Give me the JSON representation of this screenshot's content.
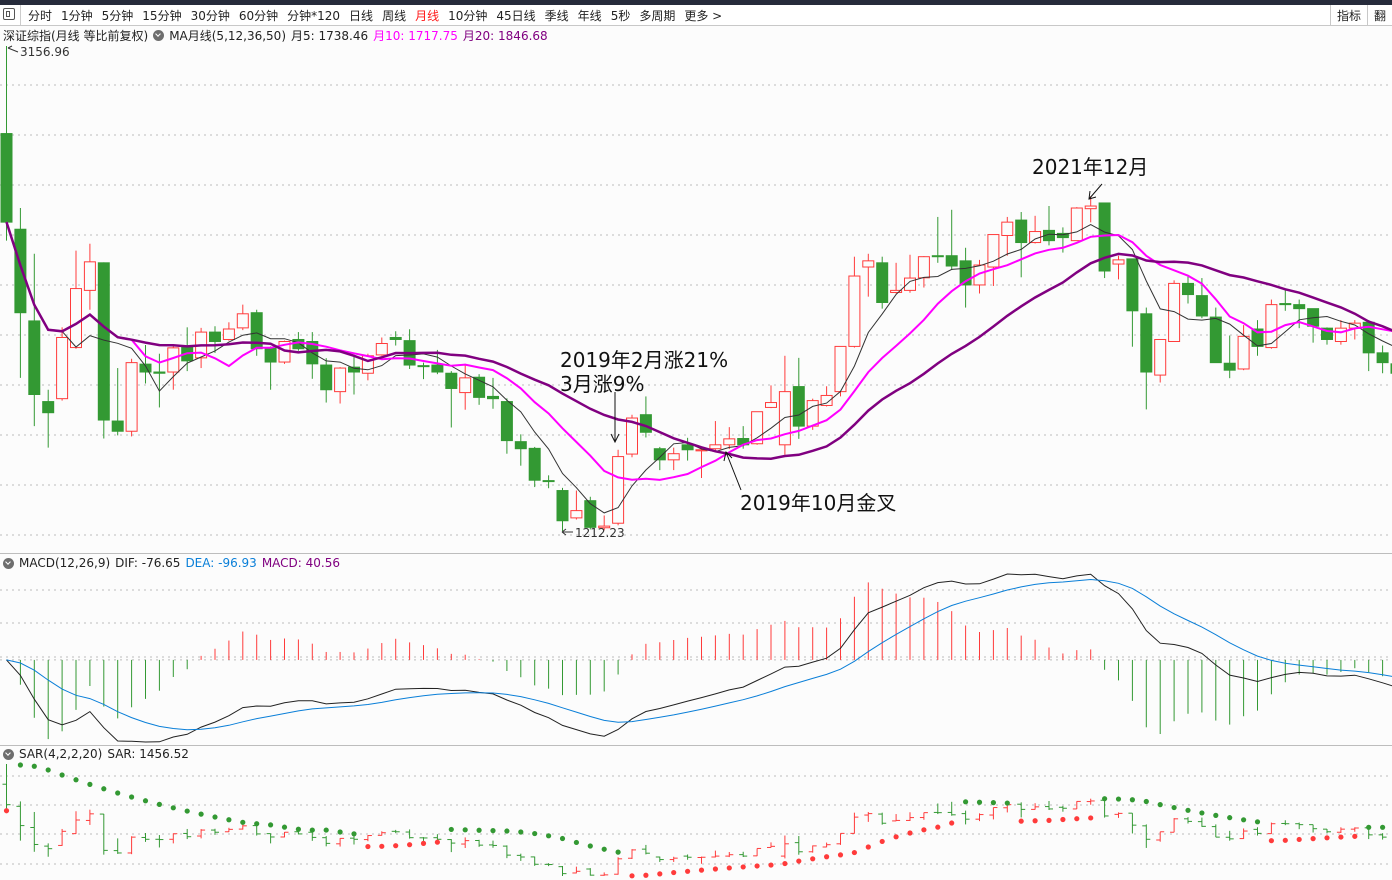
{
  "toolbar": {
    "items": [
      "分时",
      "1分钟",
      "5分钟",
      "15分钟",
      "30分钟",
      "60分钟",
      "分钟*120",
      "日线",
      "周线",
      "月线",
      "10分钟",
      "45日线",
      "季线",
      "年线",
      "5秒",
      "多周期",
      "更多 >"
    ],
    "active_index": 9,
    "right": [
      "指标",
      "翻"
    ]
  },
  "main_legend": {
    "title": "深证综指(月线 等比前复权)",
    "indicator": "MA月线(5,12,36,50)",
    "ma5": "月5: 1738.46",
    "ma10": "月10: 1717.75",
    "ma20": "月20: 1846.68"
  },
  "price_labels": {
    "high": "3156.96",
    "low": "1212.23"
  },
  "annotations": {
    "feb2019_line1": "2019年2月涨21%",
    "feb2019_line2": "3月涨9%",
    "golden_cross": "2019年10月金叉",
    "dec2021": "2021年12月"
  },
  "macd_legend": {
    "title": "MACD(12,26,9)",
    "dif": "DIF: -76.65",
    "dea": "DEA: -96.93",
    "macd": "MACD: 40.56"
  },
  "sar_legend": {
    "title": "SAR(4,2,2,20)",
    "sar": "SAR: 1456.52"
  },
  "colors": {
    "up": "#ff3b3b",
    "down": "#339933",
    "ma5": "#333333",
    "ma10": "#ff00ff",
    "ma20": "#800080",
    "dea": "#0a7fd8",
    "macd_label": "#800080"
  },
  "chart_data": {
    "type": "candlestick",
    "title": "深证综指 月线",
    "scale": "log",
    "ohlc": [
      [
        2656,
        3156.96,
        2150,
        2230
      ],
      [
        2199,
        2293,
        1640,
        1865
      ],
      [
        1835,
        2095,
        1491,
        1587
      ],
      [
        1565,
        1602,
        1429,
        1531
      ],
      [
        1574,
        1812,
        1568,
        1776
      ],
      [
        1741,
        2108,
        1737,
        1956
      ],
      [
        1949,
        2137,
        1876,
        2062
      ],
      [
        2058,
        2060,
        1455,
        1509
      ],
      [
        1506,
        1672,
        1464,
        1476
      ],
      [
        1476,
        1703,
        1461,
        1690
      ],
      [
        1685,
        1750,
        1622,
        1659
      ],
      [
        1659,
        1720,
        1547,
        1655
      ],
      [
        1659,
        1745,
        1602,
        1740
      ],
      [
        1744,
        1812,
        1662,
        1696
      ],
      [
        1706,
        1810,
        1672,
        1795
      ],
      [
        1795,
        1816,
        1723,
        1762
      ],
      [
        1769,
        1830,
        1765,
        1806
      ],
      [
        1810,
        1895,
        1802,
        1861
      ],
      [
        1865,
        1876,
        1713,
        1737
      ],
      [
        1741,
        1745,
        1602,
        1692
      ],
      [
        1692,
        1765,
        1686,
        1762
      ],
      [
        1769,
        1795,
        1730,
        1737
      ],
      [
        1762,
        1795,
        1637,
        1686
      ],
      [
        1682,
        1705,
        1562,
        1602
      ],
      [
        1596,
        1675,
        1559,
        1672
      ],
      [
        1675,
        1713,
        1587,
        1659
      ],
      [
        1655,
        1720,
        1632,
        1713
      ],
      [
        1716,
        1776,
        1713,
        1755
      ],
      [
        1776,
        1798,
        1748,
        1769
      ],
      [
        1765,
        1805,
        1669,
        1682
      ],
      [
        1680,
        1690,
        1636,
        1678
      ],
      [
        1682,
        1733,
        1652,
        1659
      ],
      [
        1655,
        1662,
        1487,
        1606
      ],
      [
        1593,
        1686,
        1540,
        1640
      ],
      [
        1642,
        1652,
        1555,
        1578
      ],
      [
        1581,
        1640,
        1543,
        1574
      ],
      [
        1565,
        1575,
        1412,
        1449
      ],
      [
        1446,
        1467,
        1379,
        1426
      ],
      [
        1427,
        1431,
        1322,
        1340
      ],
      [
        1339,
        1353,
        1319,
        1337
      ],
      [
        1313,
        1320,
        1212.23,
        1237
      ],
      [
        1244,
        1313,
        1240,
        1262
      ],
      [
        1287,
        1297,
        1216,
        1221
      ],
      [
        1220,
        1250,
        1214,
        1224
      ],
      [
        1231,
        1423,
        1226,
        1404
      ],
      [
        1411,
        1525,
        1402,
        1515
      ],
      [
        1525,
        1581,
        1458,
        1473
      ],
      [
        1426,
        1431,
        1367,
        1395
      ],
      [
        1395,
        1429,
        1367,
        1412
      ],
      [
        1437,
        1457,
        1393,
        1423
      ],
      [
        1420,
        1430,
        1346,
        1423
      ],
      [
        1426,
        1506,
        1420,
        1437
      ],
      [
        1437,
        1488,
        1425,
        1454
      ],
      [
        1455,
        1491,
        1426,
        1437
      ],
      [
        1440,
        1534,
        1437,
        1534
      ],
      [
        1547,
        1616,
        1545,
        1562
      ],
      [
        1437,
        1713,
        1409,
        1596
      ],
      [
        1612,
        1706,
        1454,
        1491
      ],
      [
        1491,
        1574,
        1480,
        1568
      ],
      [
        1553,
        1613,
        1550,
        1584
      ],
      [
        1596,
        1745,
        1581,
        1745
      ],
      [
        1745,
        2083,
        1741,
        2005
      ],
      [
        2041,
        2095,
        1925,
        2066
      ],
      [
        2058,
        2083,
        1880,
        1903
      ],
      [
        1941,
        2058,
        1937,
        1949
      ],
      [
        1949,
        2091,
        1940,
        1997
      ],
      [
        1998,
        2085,
        1960,
        2083
      ],
      [
        2087,
        2253,
        2058,
        2083
      ],
      [
        2087,
        2285,
        2029,
        2045
      ],
      [
        2066,
        2120,
        1884,
        1970
      ],
      [
        1970,
        2070,
        1937,
        2049
      ],
      [
        2041,
        2176,
        1966,
        2176
      ],
      [
        2172,
        2253,
        2087,
        2230
      ],
      [
        2239,
        2275,
        2000,
        2142
      ],
      [
        2142,
        2258,
        2138,
        2189
      ],
      [
        2194,
        2302,
        2130,
        2150
      ],
      [
        2181,
        2207,
        2100,
        2163
      ],
      [
        2150,
        2297,
        2150,
        2293
      ],
      [
        2290,
        2347,
        2229,
        2302
      ],
      [
        2316,
        2316,
        1997,
        2025
      ],
      [
        2053,
        2087,
        1992,
        2070
      ],
      [
        2074,
        2074,
        1744,
        1872
      ],
      [
        1861,
        1884,
        1541,
        1659
      ],
      [
        1649,
        1769,
        1625,
        1769
      ],
      [
        1762,
        1988,
        1762,
        1976
      ],
      [
        1976,
        2005,
        1899,
        1933
      ],
      [
        1929,
        1997,
        1845,
        1853
      ],
      [
        1849,
        1884,
        1690,
        1690
      ],
      [
        1688,
        1783,
        1639,
        1665
      ],
      [
        1669,
        1820,
        1665,
        1780
      ],
      [
        1806,
        1838,
        1713,
        1745
      ],
      [
        1741,
        1914,
        1737,
        1895
      ],
      [
        1899,
        1952,
        1872,
        1895
      ],
      [
        1895,
        1914,
        1809,
        1880
      ],
      [
        1880,
        1880,
        1758,
        1816
      ],
      [
        1809,
        1812,
        1751,
        1769
      ],
      [
        1762,
        1838,
        1751,
        1809
      ],
      [
        1809,
        1838,
        1769,
        1827
      ],
      [
        1830,
        1838,
        1662,
        1723
      ],
      [
        1723,
        1748,
        1655,
        1690
      ],
      [
        1686,
        1700,
        1640,
        1655
      ]
    ],
    "ma_periods": [
      5,
      10,
      20
    ],
    "macd_params": [
      12,
      26,
      9
    ],
    "sar_params": [
      4,
      2,
      2,
      20
    ],
    "ylim": [
      1212.23,
      3156.96
    ],
    "grid": true
  }
}
